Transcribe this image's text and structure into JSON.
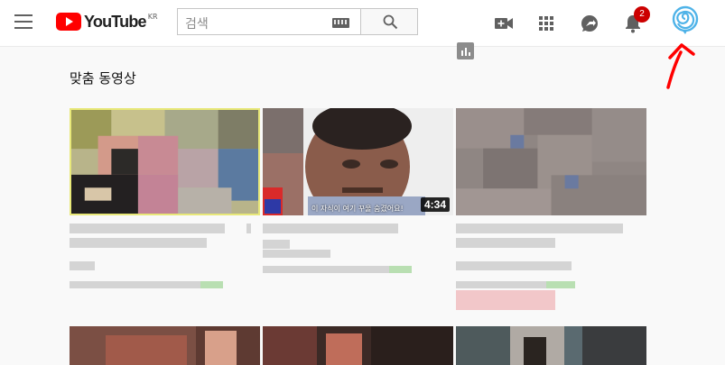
{
  "header": {
    "logo_text": "YouTube",
    "logo_region": "KR",
    "search_placeholder": "검색",
    "notification_count": "2",
    "icons": [
      "menu-icon",
      "keyboard-icon",
      "search-icon",
      "video-camera-icon",
      "apps-grid-icon",
      "messages-icon",
      "bell-icon",
      "avatar-swirl-icon"
    ]
  },
  "section": {
    "title": "맞춤 동영상"
  },
  "videos": [
    {
      "duration": "",
      "caption": ""
    },
    {
      "duration": "4:34",
      "caption": "이 자식이 여기 꾸울 숨겼어요!"
    },
    {
      "duration": "",
      "caption": ""
    }
  ],
  "colors": {
    "brand_red": "#ff0000",
    "badge_red": "#cc0000",
    "annotation_red": "#ff0000",
    "avatar_blue": "#4fb3e8"
  }
}
